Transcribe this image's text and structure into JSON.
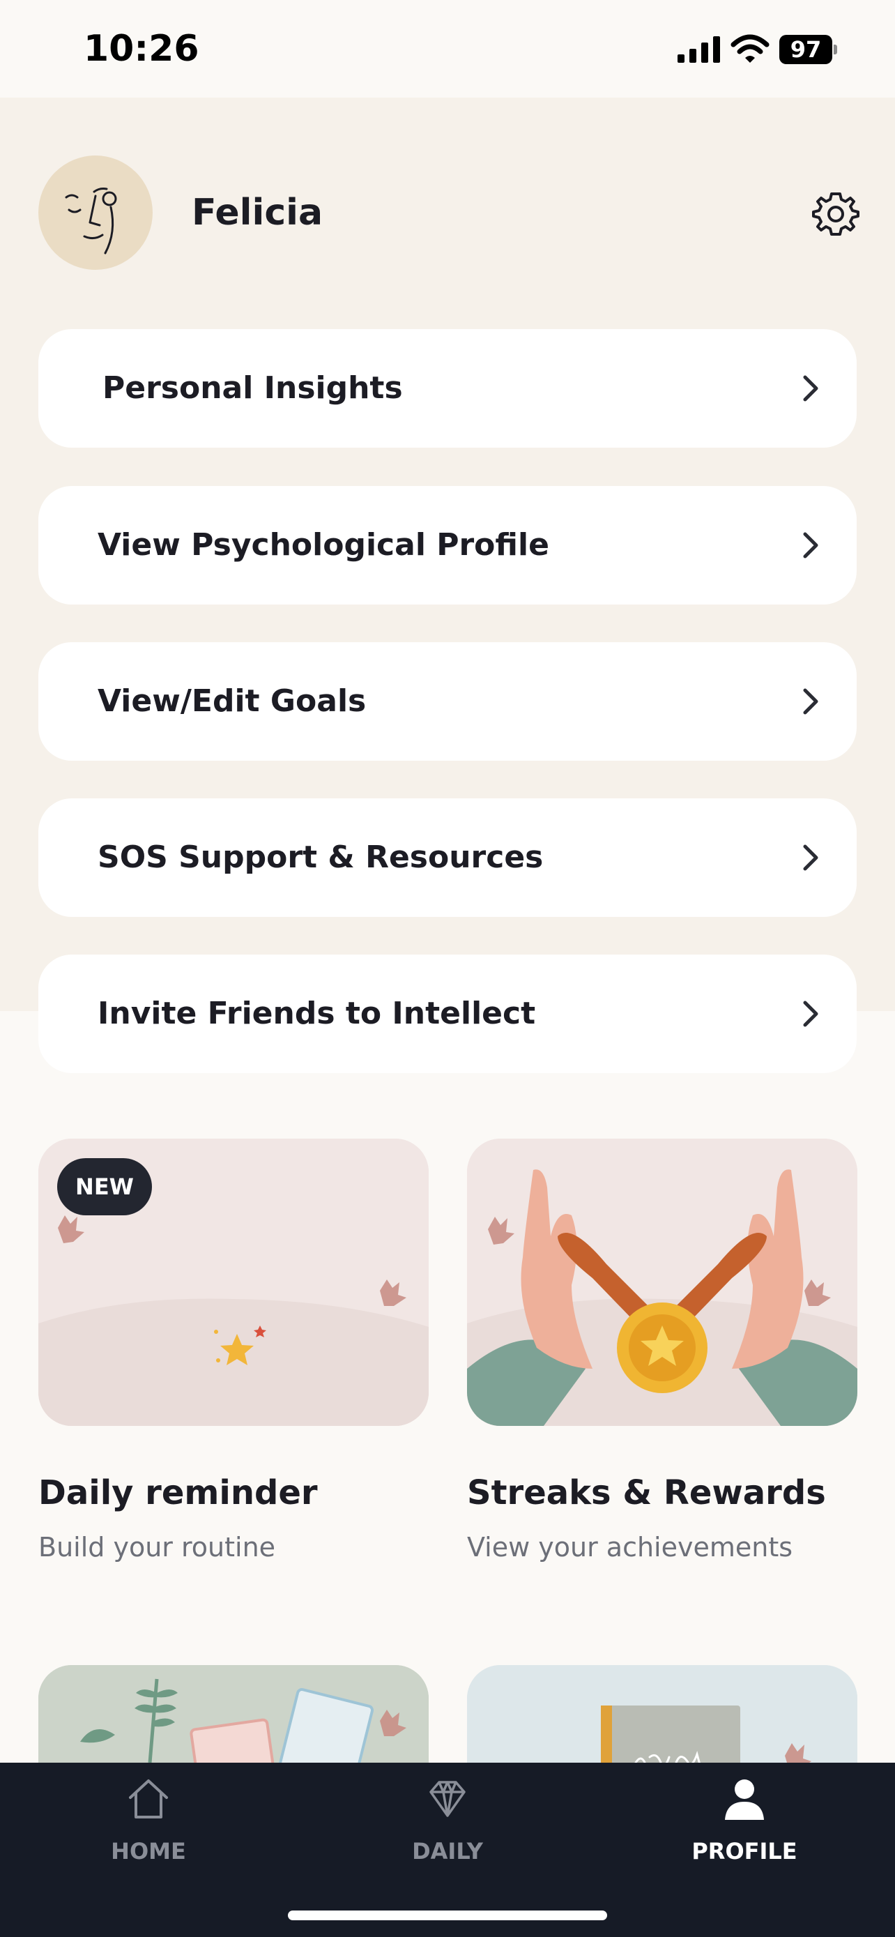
{
  "status_bar": {
    "time": "10:26",
    "battery": "97"
  },
  "profile": {
    "name": "Felicia"
  },
  "menu": [
    {
      "label": "Personal Insights"
    },
    {
      "label": "View Psychological Profile"
    },
    {
      "label": "View/Edit Goals"
    },
    {
      "label": "SOS Support & Resources"
    },
    {
      "label": "Invite Friends to Intellect"
    }
  ],
  "tiles": [
    {
      "badge": "NEW",
      "title": "Daily reminder",
      "subtitle": "Build your routine"
    },
    {
      "title": "Streaks & Rewards",
      "subtitle": "View your achievements"
    }
  ],
  "tab_bar": {
    "items": [
      {
        "label": "HOME",
        "icon": "home-icon",
        "active": false
      },
      {
        "label": "DAILY",
        "icon": "diamond-icon",
        "active": false
      },
      {
        "label": "PROFILE",
        "icon": "person-icon",
        "active": true
      }
    ]
  },
  "colors": {
    "page_bg": "#fbf9f6",
    "header_bg": "#f6f1ea",
    "card_bg": "#ffffff",
    "tabbar_bg": "#161b26",
    "accent_dark": "#1c1c24"
  }
}
